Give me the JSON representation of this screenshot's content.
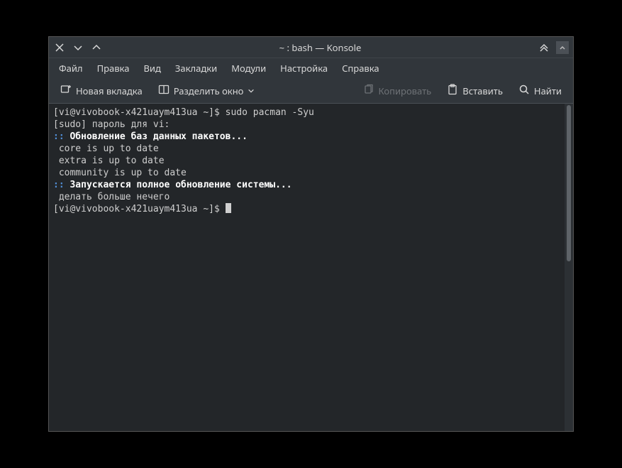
{
  "titlebar": {
    "title": "~ : bash — Konsole"
  },
  "menu": {
    "file": "Файл",
    "edit": "Правка",
    "view": "Вид",
    "bookmarks": "Закладки",
    "plugins": "Модули",
    "settings": "Настройка",
    "help": "Справка"
  },
  "toolbar": {
    "new_tab": "Новая вкладка",
    "split_view": "Разделить окно",
    "copy": "Копировать",
    "paste": "Вставить",
    "find": "Найти"
  },
  "terminal": {
    "lines": [
      {
        "segments": [
          {
            "t": "[vi@vivobook-x421uaym413ua ~]$ sudo pacman -Syu"
          }
        ]
      },
      {
        "segments": [
          {
            "t": "[sudo] пароль для vi:"
          }
        ]
      },
      {
        "segments": [
          {
            "t": ":: ",
            "c": "blue"
          },
          {
            "t": "Обновление баз данных пакетов...",
            "c": "bold"
          }
        ]
      },
      {
        "segments": [
          {
            "t": " core is up to date"
          }
        ]
      },
      {
        "segments": [
          {
            "t": " extra is up to date"
          }
        ]
      },
      {
        "segments": [
          {
            "t": " community is up to date"
          }
        ]
      },
      {
        "segments": [
          {
            "t": ":: ",
            "c": "blue"
          },
          {
            "t": "Запускается полное обновление системы...",
            "c": "bold"
          }
        ]
      },
      {
        "segments": [
          {
            "t": " делать больше нечего"
          }
        ]
      },
      {
        "segments": [
          {
            "t": "[vi@vivobook-x421uaym413ua ~]$ "
          },
          {
            "cursor": true
          }
        ]
      }
    ]
  }
}
